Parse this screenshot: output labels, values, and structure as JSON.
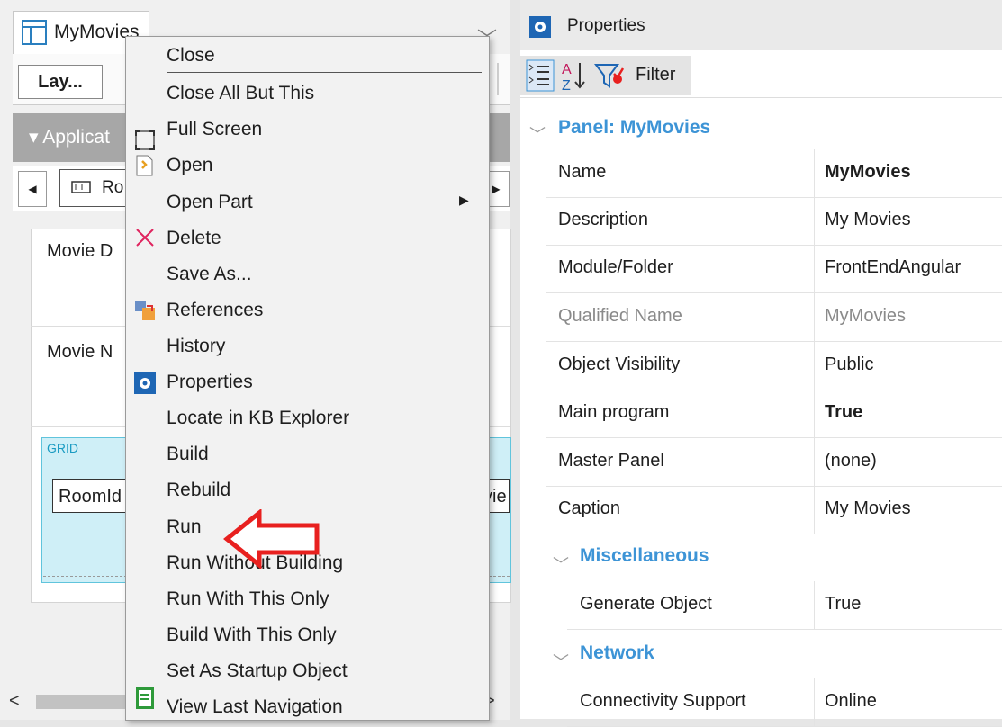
{
  "editor": {
    "tab_title": "MyMovies",
    "tab_close": "✕",
    "layout_button": "Lay...",
    "app_bar_label": "Applicat",
    "crumb_item": "Ro",
    "field_labels": [
      "Movie D",
      "Movie N"
    ],
    "grid_label": "GRID",
    "grid_cells": [
      "RoomId",
      "vie"
    ]
  },
  "context_menu": {
    "items": [
      {
        "label": "Close",
        "icon": null
      },
      {
        "label": "Close All But This",
        "icon": null
      },
      {
        "label": "Full Screen",
        "icon": "fullscreen-icon"
      },
      {
        "label": "Open",
        "icon": "open-icon"
      },
      {
        "label": "Open Part",
        "icon": null,
        "submenu": true
      },
      {
        "label": "Delete",
        "icon": "delete-icon"
      },
      {
        "label": "Save As...",
        "icon": null
      },
      {
        "label": "References",
        "icon": "references-icon"
      },
      {
        "label": "History",
        "icon": null
      },
      {
        "label": "Properties",
        "icon": "properties-icon"
      },
      {
        "label": "Locate in KB Explorer",
        "icon": null
      },
      {
        "label": "Build",
        "icon": null
      },
      {
        "label": "Rebuild",
        "icon": null
      },
      {
        "label": "Run",
        "icon": null
      },
      {
        "label": "Run Without Building",
        "icon": null
      },
      {
        "label": "Run With This Only",
        "icon": null
      },
      {
        "label": "Build With This Only",
        "icon": null
      },
      {
        "label": "Set As Startup Object",
        "icon": null
      },
      {
        "label": "View Last Navigation",
        "icon": "navigation-icon"
      }
    ]
  },
  "properties": {
    "title": "Properties",
    "filter_label": "Filter",
    "category_main": "Panel: MyMovies",
    "rows": [
      {
        "key": "Name",
        "value": "MyMovies",
        "bold": true
      },
      {
        "key": "Description",
        "value": "My Movies"
      },
      {
        "key": "Module/Folder",
        "value": "FrontEndAngular"
      },
      {
        "key": "Qualified Name",
        "value": "MyMovies",
        "muted": true
      },
      {
        "key": "Object Visibility",
        "value": "Public"
      },
      {
        "key": "Main program",
        "value": "True",
        "bold": true
      },
      {
        "key": "Master Panel",
        "value": "(none)"
      },
      {
        "key": "Caption",
        "value": "My Movies"
      }
    ],
    "category_misc": "Miscellaneous",
    "misc_rows": [
      {
        "key": "Generate Object",
        "value": "True"
      }
    ],
    "category_network": "Network",
    "network_rows": [
      {
        "key": "Connectivity Support",
        "value": "Online"
      }
    ]
  },
  "colors": {
    "accent": "#3d94d6",
    "highlight_arrow": "#e8201f",
    "grid_bg": "#cfeff7"
  }
}
